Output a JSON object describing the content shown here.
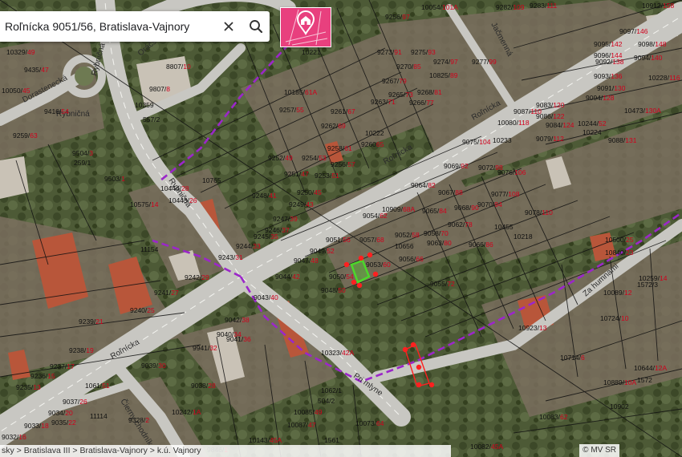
{
  "search": {
    "value": "Roľnícka 9051/56, Bratislava-Vajnory"
  },
  "icons": {
    "clear": "close-icon",
    "search": "search-icon",
    "logo": "map-pin-house-icon"
  },
  "breadcrumb": "sky > Bratislava III > Bratislava-Vajnory > k.ú. Vajnory",
  "copyright": "© MV SR",
  "colors": {
    "brand": "#e8407e",
    "parcel_number": "#d1001c",
    "boundary": "#9b27c9",
    "selected": "#4cd82a",
    "vertex": "#ff2020"
  },
  "streets": [
    {
      "name": "Roľnícka"
    },
    {
      "name": "Roľnícka"
    },
    {
      "name": "Roľnícka"
    },
    {
      "name": "Rybničná"
    },
    {
      "name": "Rybničná"
    },
    {
      "name": "Rybničná"
    },
    {
      "name": "Dorastenecká"
    },
    {
      "name": "Oráčska"
    },
    {
      "name": "Jačmenná"
    },
    {
      "name": "Pri mlyne"
    },
    {
      "name": "Čierny chodník"
    },
    {
      "name": "Za humnami"
    }
  ],
  "parcels": [
    {
      "b": "10054/",
      "r": "101A"
    },
    {
      "b": "9282/",
      "r": "109"
    },
    {
      "b": "9283/",
      "r": "111"
    },
    {
      "b": "10912/",
      "r": "158"
    },
    {
      "b": "9256/",
      "r": "97"
    },
    {
      "b": "9097/",
      "r": "146"
    },
    {
      "b": "9098/",
      "r": "148"
    },
    {
      "b": "10221",
      "r": ""
    },
    {
      "b": "10329/",
      "r": "49"
    },
    {
      "b": "9273/",
      "r": "91"
    },
    {
      "b": "9275/",
      "r": "93"
    },
    {
      "b": "9095/",
      "r": "142"
    },
    {
      "b": "9096/",
      "r": "144"
    },
    {
      "b": "9435/",
      "r": "47"
    },
    {
      "b": "8807/",
      "r": "10"
    },
    {
      "b": "9270/",
      "r": "85"
    },
    {
      "b": "9274/",
      "r": "97"
    },
    {
      "b": "9277/",
      "r": "99"
    },
    {
      "b": "9092/",
      "r": "138"
    },
    {
      "b": "9094/",
      "r": "140"
    },
    {
      "b": "10050/",
      "r": "45"
    },
    {
      "b": "9807/",
      "r": "8"
    },
    {
      "b": "9267/",
      "r": "79"
    },
    {
      "b": "10825/",
      "r": "89"
    },
    {
      "b": "9093/",
      "r": "136"
    },
    {
      "b": "10228/",
      "r": "116"
    },
    {
      "b": "10185/",
      "r": "61A"
    },
    {
      "b": "9268/",
      "r": "81"
    },
    {
      "b": "9265/",
      "r": "73"
    },
    {
      "b": "9266/",
      "r": "77"
    },
    {
      "b": "9091/",
      "r": "130"
    },
    {
      "b": "9094/",
      "r": "128"
    },
    {
      "b": "9416/",
      "r": "54"
    },
    {
      "b": "10359",
      "r": ""
    },
    {
      "b": "557/2",
      "r": ""
    },
    {
      "b": "9257/",
      "r": "55"
    },
    {
      "b": "9261/",
      "r": "67"
    },
    {
      "b": "9263/",
      "r": "71"
    },
    {
      "b": "9083/",
      "r": "120"
    },
    {
      "b": "9087/",
      "r": "110"
    },
    {
      "b": "10473/",
      "r": "130A"
    },
    {
      "b": "9086/",
      "r": "122"
    },
    {
      "b": "10080/",
      "r": "118"
    },
    {
      "b": "9084/",
      "r": "124"
    },
    {
      "b": "10244/",
      "r": "52"
    },
    {
      "b": "9259/",
      "r": "63"
    },
    {
      "b": "9262/",
      "r": "69"
    },
    {
      "b": "10222",
      "r": ""
    },
    {
      "b": "9075/",
      "r": "104"
    },
    {
      "b": "10233",
      "r": ""
    },
    {
      "b": "9079/",
      "r": "112"
    },
    {
      "b": "10224",
      "r": ""
    },
    {
      "b": "9088/",
      "r": "131"
    },
    {
      "b": "9504/",
      "r": "3"
    },
    {
      "b": "259/1",
      "r": ""
    },
    {
      "b": "9258/",
      "r": "61"
    },
    {
      "b": "9260",
      "r": "65"
    },
    {
      "b": "9252/",
      "r": "49"
    },
    {
      "b": "9254/",
      "r": "53"
    },
    {
      "b": "9256/",
      "r": "57"
    },
    {
      "b": "9069/",
      "r": "92"
    },
    {
      "b": "9072/",
      "r": "98"
    },
    {
      "b": "9076/",
      "r": "106"
    },
    {
      "b": "10765",
      "r": ""
    },
    {
      "b": "9251/",
      "r": "47"
    },
    {
      "b": "9253/",
      "r": "51"
    },
    {
      "b": "9503/",
      "r": "1"
    },
    {
      "b": "10444/",
      "r": "28"
    },
    {
      "b": "9064/",
      "r": "82"
    },
    {
      "b": "9067/",
      "r": "88"
    },
    {
      "b": "9077/",
      "r": "108"
    },
    {
      "b": "9248/",
      "r": "41"
    },
    {
      "b": "9250/",
      "r": "45"
    },
    {
      "b": "10443/",
      "r": "26"
    },
    {
      "b": "9249/",
      "r": "43"
    },
    {
      "b": "10575/",
      "r": "14"
    },
    {
      "b": "10909/",
      "r": "68A"
    },
    {
      "b": "9065/",
      "r": "84"
    },
    {
      "b": "9068/",
      "r": "90"
    },
    {
      "b": "9070/",
      "r": "94"
    },
    {
      "b": "9078/",
      "r": "110"
    },
    {
      "b": "9247/",
      "r": "39"
    },
    {
      "b": "9054/",
      "r": "62"
    },
    {
      "b": "9062/",
      "r": "78"
    },
    {
      "b": "9246/",
      "r": "37"
    },
    {
      "b": "10455",
      "r": ""
    },
    {
      "b": "10218",
      "r": ""
    },
    {
      "b": "9052/",
      "r": "58"
    },
    {
      "b": "9058/",
      "r": "70"
    },
    {
      "b": "9245/",
      "r": "35"
    },
    {
      "b": "9063/",
      "r": "80"
    },
    {
      "b": "9066/",
      "r": "86"
    },
    {
      "b": "10500/",
      "r": "25"
    },
    {
      "b": "9244/",
      "r": "33"
    },
    {
      "b": "9051/",
      "r": "56"
    },
    {
      "b": "9057/",
      "r": "68"
    },
    {
      "b": "10656",
      "r": ""
    },
    {
      "b": "11154",
      "r": ""
    },
    {
      "b": "9049/",
      "r": "52"
    },
    {
      "b": "10840/",
      "r": "23"
    },
    {
      "b": "9243/",
      "r": "31"
    },
    {
      "b": "9047/",
      "r": "48"
    },
    {
      "b": "9053/",
      "r": "60"
    },
    {
      "b": "9056/",
      "r": "66"
    },
    {
      "b": "9044/",
      "r": "42"
    },
    {
      "b": "9050/",
      "r": "54"
    },
    {
      "b": "10259/",
      "r": "14"
    },
    {
      "b": "9242/",
      "r": "29"
    },
    {
      "b": "1572/3",
      "r": ""
    },
    {
      "b": "9055/",
      "r": "72"
    },
    {
      "b": "9241/",
      "r": "27"
    },
    {
      "b": "9048/",
      "r": "50"
    },
    {
      "b": "10089/",
      "r": "12"
    },
    {
      "b": "9043/",
      "r": "40"
    },
    {
      "b": "9240/",
      "r": "25"
    },
    {
      "b": "9042/",
      "r": "38"
    },
    {
      "b": "9239/",
      "r": "21"
    },
    {
      "b": "10724/",
      "r": "10"
    },
    {
      "b": "9040/",
      "r": "34"
    },
    {
      "b": "9041/",
      "r": "36"
    },
    {
      "b": "10923/",
      "r": "13"
    },
    {
      "b": "9238/",
      "r": "19"
    },
    {
      "b": "9941/",
      "r": "32"
    },
    {
      "b": "10323/",
      "r": "42A"
    },
    {
      "b": "10714/",
      "r": "6"
    },
    {
      "b": "10644/",
      "r": "12A"
    },
    {
      "b": "9236/",
      "r": "15"
    },
    {
      "b": "9237/",
      "r": "17"
    },
    {
      "b": "9039/",
      "r": "30"
    },
    {
      "b": "1572",
      "r": ""
    },
    {
      "b": "9235/",
      "r": "13"
    },
    {
      "b": "9038/",
      "r": "28"
    },
    {
      "b": "1062/1",
      "r": ""
    },
    {
      "b": "10889/",
      "r": "10A"
    },
    {
      "b": "504/2",
      "r": ""
    },
    {
      "b": "1061/",
      "r": "51"
    },
    {
      "b": "9037/",
      "r": "26"
    },
    {
      "b": "10902",
      "r": ""
    },
    {
      "b": "9034/",
      "r": "20"
    },
    {
      "b": "11114",
      "r": ""
    },
    {
      "b": "10242/",
      "r": "1A"
    },
    {
      "b": "10085/",
      "r": "49"
    },
    {
      "b": "9035/",
      "r": "22"
    },
    {
      "b": "9328/",
      "r": "2"
    },
    {
      "b": "9033/",
      "r": "18"
    },
    {
      "b": "10073/",
      "r": "64"
    },
    {
      "b": "10087/",
      "r": "47"
    },
    {
      "b": "9032/",
      "r": "16"
    },
    {
      "b": "10143/",
      "r": "45A"
    },
    {
      "b": "10083/",
      "r": "62"
    },
    {
      "b": "1561",
      "r": ""
    },
    {
      "b": "10082/",
      "r": "45A"
    },
    {
      "b": "9846/",
      "r": "1"
    }
  ]
}
